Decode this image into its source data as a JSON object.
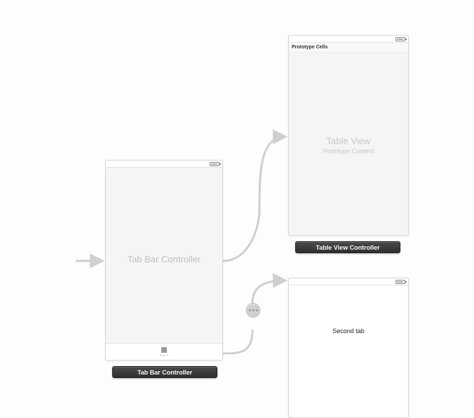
{
  "tab_bar_controller": {
    "placeholder_label": "Tab Bar Controller",
    "tab_item_label": "Item 2",
    "caption": "Tab Bar Controller"
  },
  "table_view_controller": {
    "prototype_header": "Prototype Cells",
    "placeholder_line1": "Table View",
    "placeholder_line2": "Prototype Content",
    "caption": "Table View Controller"
  },
  "second_tab": {
    "label": "Second tab"
  },
  "icons": {
    "battery": "battery-icon",
    "tab_square": "tab-square-icon",
    "segue_relationship": "relationship-segue-icon"
  }
}
